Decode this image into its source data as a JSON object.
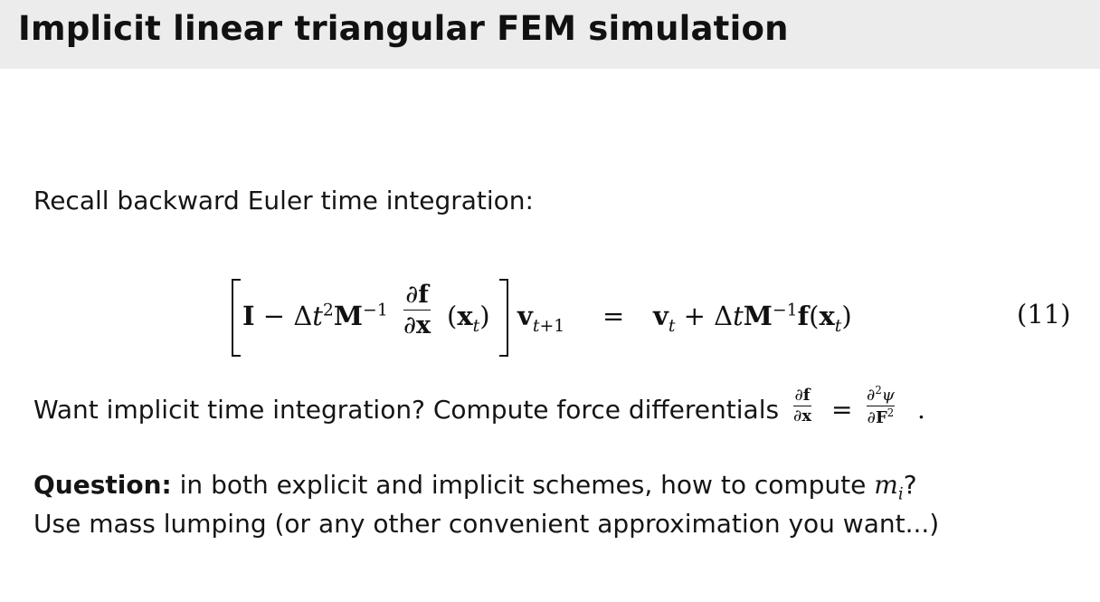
{
  "header": {
    "title": "Implicit linear triangular FEM simulation"
  },
  "slide": {
    "line1": "Recall backward Euler time integration:",
    "equation": {
      "number": "(11)"
    },
    "line2_prefix": "Want implicit time integration? Compute force differentials",
    "question_label": "Question:",
    "question_text": "in both explicit and implicit schemes, how to compute",
    "question_symbol": "m",
    "question_subscript": "i",
    "question_end": "?",
    "line4": "Use mass lumping (or any other convenient approximation you want...)"
  }
}
